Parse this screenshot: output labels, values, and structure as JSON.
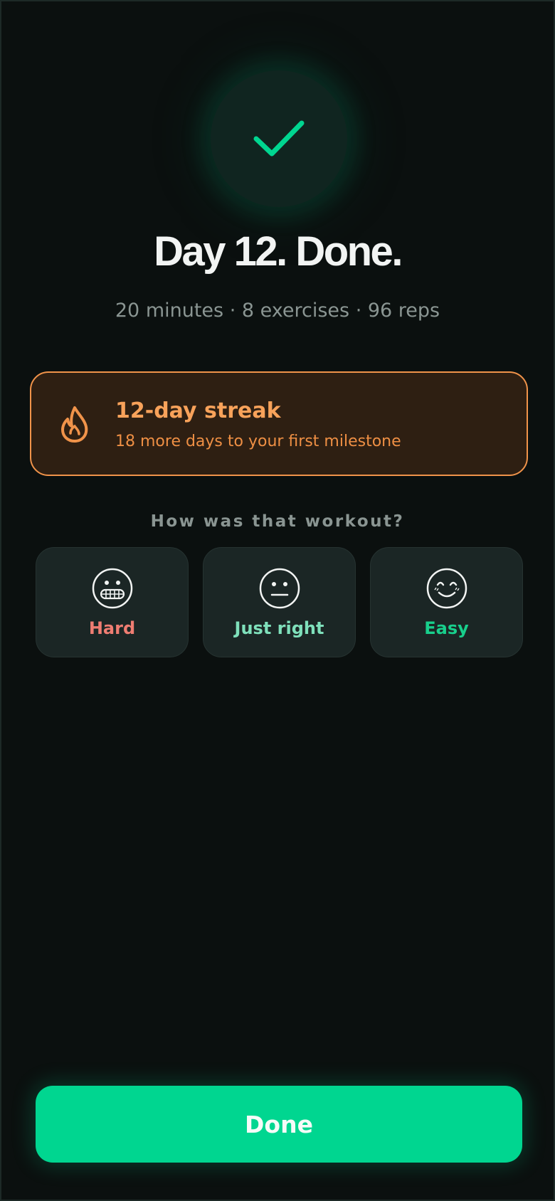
{
  "completion": {
    "title": "Day 12. Done.",
    "stats": "20 minutes · 8 exercises · 96 reps",
    "icon": "checkmark-icon",
    "accent_color": "#00d690"
  },
  "streak": {
    "title": "12-day streak",
    "subtitle": "18 more days to your first milestone",
    "icon": "flame-icon",
    "color": "#f0934a"
  },
  "feedback": {
    "question": "How was that workout?",
    "options": [
      {
        "label": "Hard",
        "icon": "grimace-face-icon",
        "color": "#ef7d72"
      },
      {
        "label": "Just right",
        "icon": "neutral-face-icon",
        "color": "#7fe0bb"
      },
      {
        "label": "Easy",
        "icon": "smiling-face-icon",
        "color": "#18cf8c"
      }
    ]
  },
  "footer": {
    "done_label": "Done"
  }
}
